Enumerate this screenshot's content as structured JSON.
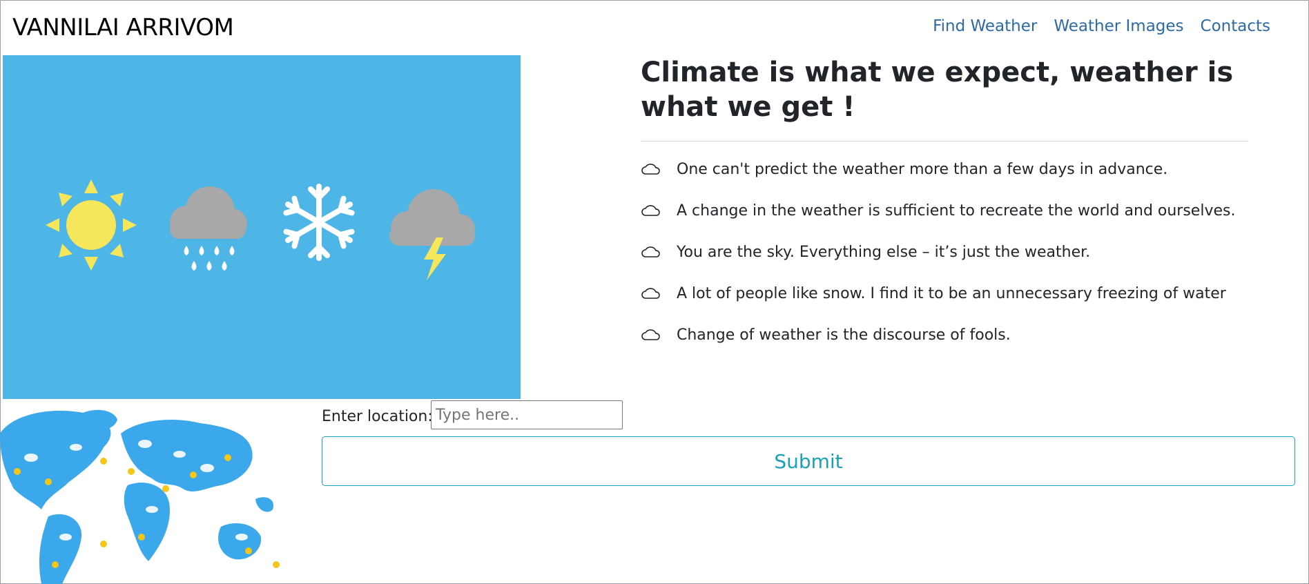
{
  "navbar": {
    "brand": "VANNILAI ARRIVOM",
    "links": [
      {
        "label": "Find Weather"
      },
      {
        "label": "Weather Images"
      },
      {
        "label": "Contacts"
      }
    ]
  },
  "hero": {
    "icons": [
      "sun-icon",
      "rain-cloud-icon",
      "snowflake-icon",
      "storm-cloud-icon"
    ],
    "background_color": "#4db6e7"
  },
  "quotes": {
    "headline": "Climate is what we expect, weather is what we get !",
    "icon": "cloud-icon",
    "items": [
      "One can't predict the weather more than a few days in advance.",
      "A change in the weather is sufficient to recreate the world and ourselves.",
      "You are the sky. Everything else – it’s just the weather.",
      "A lot of people like snow. I find it to be an unnecessary freezing of water",
      "Change of weather is the discourse of fools."
    ]
  },
  "form": {
    "label": "Enter location:",
    "placeholder": "Type here..",
    "value": "",
    "submit_label": "Submit"
  },
  "colors": {
    "link": "#2d6aa3",
    "accent": "#17a2b8",
    "hero_bg": "#4db6e7",
    "sun": "#f6e65b",
    "cloud": "#a8a8a8"
  }
}
